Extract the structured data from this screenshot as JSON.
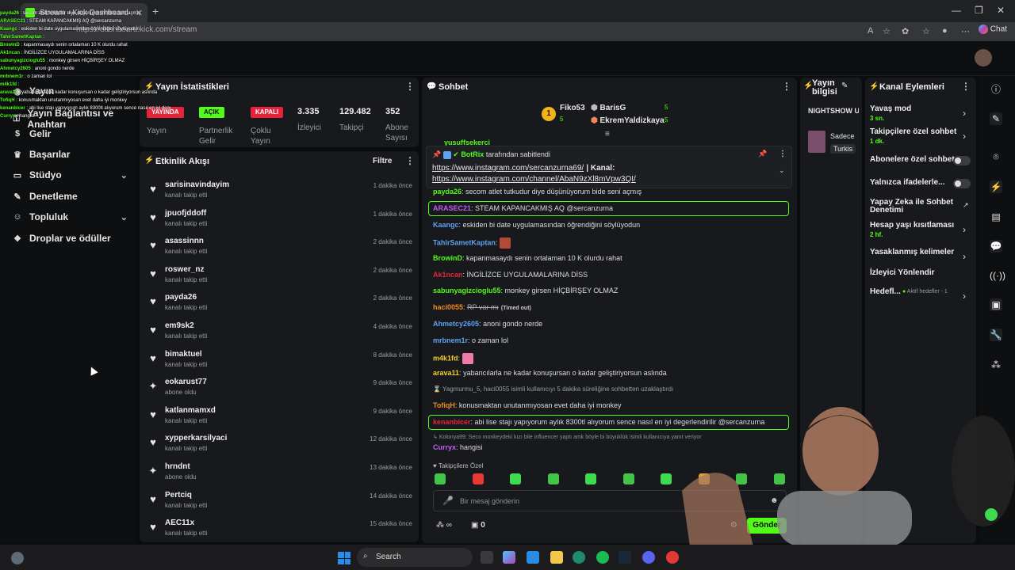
{
  "browser": {
    "tab_title": "Stream - Kick Dashboard",
    "url": "https://dashboard.kick.com/stream",
    "chat_button": "Chat"
  },
  "sidebar": {
    "items": [
      {
        "label": "Yayın",
        "icon": "broadcast-icon"
      },
      {
        "label": "Yayın Bağlantısı ve Anahtarı",
        "icon": "key-icon"
      },
      {
        "label": "Gelir",
        "icon": "money-icon"
      },
      {
        "label": "Başarılar",
        "icon": "trophy-icon"
      },
      {
        "label": "Stüdyo",
        "icon": "studio-icon"
      },
      {
        "label": "Denetleme",
        "icon": "wrench-icon"
      },
      {
        "label": "Topluluk",
        "icon": "people-icon"
      },
      {
        "label": "Droplar ve ödüller",
        "icon": "gift-icon"
      }
    ]
  },
  "stats": {
    "title": "Yayın İstatistikleri",
    "badges": [
      {
        "badge": "YAYINDA",
        "label": "Yayın",
        "color": "#e5243b"
      },
      {
        "badge": "AÇIK",
        "label": "Partnerlik Gelir",
        "color": "#53fc18"
      },
      {
        "badge": "KAPALI",
        "label": "Çoklu Yayın",
        "color": "#e5243b"
      }
    ],
    "numbers": [
      {
        "value": "3.335",
        "label": "İzleyici"
      },
      {
        "value": "129.482",
        "label": "Takipçi"
      },
      {
        "value": "352",
        "label": "Abone Sayısı"
      }
    ]
  },
  "activity": {
    "title": "Etkinlik Akışı",
    "filter": "Filtre",
    "items": [
      {
        "name": "sarisinavindayim",
        "status": "kanalı takip etti",
        "time": "1 dakika önce",
        "icon": "heart-icon"
      },
      {
        "name": "jpuofjddoff",
        "status": "kanalı takip etti",
        "time": "1 dakika önce",
        "icon": "heart-icon"
      },
      {
        "name": "asassinnn",
        "status": "kanalı takip etti",
        "time": "2 dakika önce",
        "icon": "heart-icon"
      },
      {
        "name": "roswer_nz",
        "status": "kanalı takip etti",
        "time": "2 dakika önce",
        "icon": "heart-icon"
      },
      {
        "name": "payda26",
        "status": "kanalı takip etti",
        "time": "2 dakika önce",
        "icon": "heart-icon"
      },
      {
        "name": "em9sk2",
        "status": "kanalı takip etti",
        "time": "4 dakika önce",
        "icon": "heart-icon"
      },
      {
        "name": "bimaktuel",
        "status": "kanalı takip etti",
        "time": "8 dakika önce",
        "icon": "heart-icon"
      },
      {
        "name": "eokarust77",
        "status": "abone oldu",
        "time": "9 dakika önce",
        "icon": "star-icon"
      },
      {
        "name": "katlanmamxd",
        "status": "kanalı takip etti",
        "time": "9 dakika önce",
        "icon": "heart-icon"
      },
      {
        "name": "xypperkarsilyaci",
        "status": "kanalı takip etti",
        "time": "12 dakika önce",
        "icon": "heart-icon"
      },
      {
        "name": "hrndnt",
        "status": "abone oldu",
        "time": "13 dakika önce",
        "icon": "star-icon"
      },
      {
        "name": "Pertciq",
        "status": "kanalı takip etti",
        "time": "14 dakika önce",
        "icon": "heart-icon"
      },
      {
        "name": "AEC11x",
        "status": "kanalı takip etti",
        "time": "15 dakika önce",
        "icon": "heart-icon"
      }
    ]
  },
  "chat": {
    "title": "Sohbet",
    "leaderboard": [
      {
        "name": "Fiko53",
        "count": "5"
      },
      {
        "name": "BarisG",
        "count": "5"
      },
      {
        "name": "EkremYaldizkaya",
        "count": "5"
      }
    ],
    "pinned_by": "BotRix",
    "pinned_suffix": "tarafından sabitlendi",
    "pinned_link1": "https://www.instagram.com/sercanzurna69/",
    "pinned_mid": "| Kanal:",
    "pinned_link2": "https://www.instagram.com/channel/AbaN9zXl8mVpw3QI/",
    "top_partial_user": "yusuffsekerci",
    "messages": [
      {
        "user": "payda26",
        "text": "secom atlet tutkudur diye düşünüyorum bide seni açmış",
        "color": "#53fc18"
      },
      {
        "user": "ARASEC21",
        "text": "STEAM KAPANCAKMIŞ AQ @sercanzurna",
        "color": "#c05cf5",
        "highlight": true
      },
      {
        "user": "Kaangc",
        "text": "eskiden bi date uygulamasından öğrendiğini söylüyodun",
        "color": "#5ea2f2"
      },
      {
        "user": "TahirSametKaptan",
        "text": "",
        "color": "#5ea2f2",
        "emote": true
      },
      {
        "user": "BrowinD",
        "text": "kapanmasaydı senin ortalaman 10 K olurdu rahat",
        "color": "#53fc18"
      },
      {
        "user": "Ak1ncan",
        "text": "İNGİLİZCE UYGULAMALARINA DİSS",
        "color": "#e5243b"
      },
      {
        "user": "sabunyagizcioglu55",
        "text": "monkey girsen HİÇBİRŞEY OLMAZ",
        "color": "#53fc18"
      },
      {
        "user": "haci0055",
        "text": "RP var mı",
        "color": "#f28c1f",
        "timed_out": "(Timed out)"
      },
      {
        "user": "Ahmetcy2605",
        "text": "anoni gondo nerde",
        "color": "#5ea2f2"
      },
      {
        "user": "mrbnem1r",
        "text": "o zaman lol",
        "color": "#5ea2f2"
      },
      {
        "user": "m4k1fd",
        "text": "",
        "color": "#f2d024",
        "emote": true
      },
      {
        "user": "arava11",
        "text": "yabancılarla ne kadar konuşursan o kadar geliştiriyorsun aslında",
        "color": "#f2d024"
      }
    ],
    "timeout_notice": "Yagmurmu_5, haci0055 isimli kullanıcıyı 5 dakika süreliğine sohbetten uzaklaştırdı",
    "messages2": [
      {
        "user": "TofiqH",
        "text": "konusmaktan unutanmıyosan evet daha iyi monkey",
        "color": "#f28c1f"
      },
      {
        "user": "kenanbicer",
        "text": "abi lise stajı yapıyorum aylık 8300tl alıyorum sence nasıl en iyi degerlendirilir @sercanzurna",
        "color": "#e5243b",
        "highlight": true
      }
    ],
    "reply_ref": "Kolonya99: Seco monkeydeki kızı bile influencer yaptı amk böyle bi büyüklük isimli kullanıcıya yanıt veriyor",
    "last_message": {
      "user": "Curryx",
      "text": "hangisi",
      "color": "#c05cf5"
    },
    "emote_section": "Takipçilere Özel",
    "input_placeholder": "Bir mesaj gönderin",
    "points": "0",
    "send_label": "Gönder"
  },
  "stream_info": {
    "title": "Yayın bilgisi",
    "stream_title": "NIGHTSHOW UUUUUUU...",
    "preview_text": "Sadece",
    "tag": "Turkis"
  },
  "channel_actions": {
    "title": "Kanal Eylemleri",
    "items": [
      {
        "label": "Yavaş mod",
        "sub": "3 sn.",
        "control": "chevron"
      },
      {
        "label": "Takipçilere özel sohbet",
        "sub": "1 dk.",
        "control": "chevron"
      },
      {
        "label": "Abonelere özel sohbet",
        "sub": "",
        "control": "toggle"
      },
      {
        "label": "Yalnızca ifadelerle...",
        "sub": "",
        "control": "toggle"
      },
      {
        "label": "Yapay Zeka ile Sohbet Denetimi",
        "sub": "",
        "control": "external"
      },
      {
        "label": "Hesap yaşı kısıtlaması",
        "sub": "2 hf.",
        "control": "chevron"
      },
      {
        "label": "Yasaklanmış kelimeler",
        "sub": "",
        "control": "chevron"
      },
      {
        "label": "İzleyici Yönlendir",
        "sub": "",
        "control": "none"
      },
      {
        "label": "Hedefl...",
        "sub": "",
        "control": "chevron",
        "extra": "Aktif hedefler - 1"
      }
    ]
  },
  "overlay_chat": [
    {
      "user": "payda26",
      "text": "secom atlet tutkudur diye düşünüyorum bide seni açmış"
    },
    {
      "user": "ARASEC21",
      "text": "STEAM KAPANCAKMIŞ AQ @sercanzurna"
    },
    {
      "user": "Kaangc",
      "text": "eskiden bi date uygulamasından öğrendiğini söylüyodun"
    },
    {
      "user": "TahirSametKaptan",
      "text": ""
    },
    {
      "user": "BrowinD",
      "text": "kapanmasaydı senin ortalaman 10 K olurdu rahat"
    },
    {
      "user": "Ak1ncan",
      "text": "İNGİLİZCE UYGULAMALARINA DİSS"
    },
    {
      "user": "sabunyagizcioglu55",
      "text": "monkey girsen HİÇBİRŞEY OLMAZ"
    },
    {
      "user": "Ahmetcy2605",
      "text": "anoni gondo nerde"
    },
    {
      "user": "mrbnem1r",
      "text": "o zaman lol"
    },
    {
      "user": "m4k1fd",
      "text": ""
    },
    {
      "user": "arava11",
      "text": "yabancılarla ne kadar konuşursan o kadar geliştiriyorsun aslında"
    },
    {
      "user": "TofiqH",
      "text": "konusmaktan unutanmıyosan evet daha iyi monkey"
    },
    {
      "user": "kenanbicer",
      "text": "abi lise stajı yapıyorum aylık 8300tl alıyorum sence nasıl en iyi degerlendirilir @sercanzurna"
    },
    {
      "user": "Curryx",
      "text": "hangisi"
    }
  ],
  "taskbar": {
    "search_label": "Search"
  }
}
